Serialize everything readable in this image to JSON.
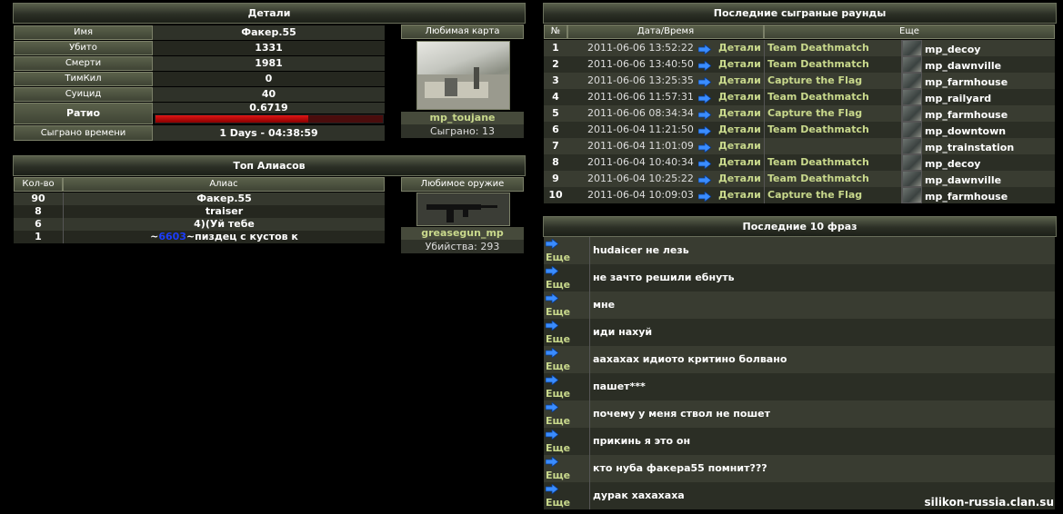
{
  "details": {
    "title": "Детали",
    "rows": [
      {
        "label": "Имя",
        "value": "Факер.55"
      },
      {
        "label": "Убито",
        "value": "1331"
      },
      {
        "label": "Смерти",
        "value": "1981"
      },
      {
        "label": "ТимКил",
        "value": "0"
      },
      {
        "label": "Суицид",
        "value": "40"
      }
    ],
    "ratio_label": "Ратио",
    "ratio_value": "0.6719",
    "ratio_fill": 0.67,
    "time_label": "Сыграно времени",
    "time_value": "1 Days - 04:38:59",
    "fav_map_title": "Любимая карта",
    "fav_map_name": "mp_toujane",
    "fav_map_played": "Сыграно: 13"
  },
  "aliases": {
    "title": "Топ Алиасов",
    "col_count": "Кол-во",
    "col_alias": "Алиас",
    "rows": [
      {
        "count": "90",
        "alias": "Факер.55"
      },
      {
        "count": "8",
        "alias": "traiser"
      },
      {
        "count": "6",
        "alias": "4)(Уй тебе"
      }
    ],
    "last_row": {
      "count": "1",
      "prefix": "~",
      "num": "6603",
      "suffix": "~пиздец с кустов к"
    },
    "fav_weapon_title": "Любимое оружие",
    "fav_weapon_name": "greasegun_mp",
    "fav_weapon_kills": "Убийства: 293"
  },
  "rounds": {
    "title": "Последние сыграные раунды",
    "col_no": "№",
    "col_date": "Дата/Время",
    "col_more": "Еще",
    "details_label": "Детали",
    "rows": [
      {
        "no": "1",
        "date": "2011-06-06 13:52:22",
        "mode": "Team Deathmatch",
        "map": "mp_decoy"
      },
      {
        "no": "2",
        "date": "2011-06-06 13:40:50",
        "mode": "Team Deathmatch",
        "map": "mp_dawnville"
      },
      {
        "no": "3",
        "date": "2011-06-06 13:25:35",
        "mode": "Capture the Flag",
        "map": "mp_farmhouse"
      },
      {
        "no": "4",
        "date": "2011-06-06 11:57:31",
        "mode": "Team Deathmatch",
        "map": "mp_railyard"
      },
      {
        "no": "5",
        "date": "2011-06-06 08:34:34",
        "mode": "Capture the Flag",
        "map": "mp_farmhouse"
      },
      {
        "no": "6",
        "date": "2011-06-04 11:21:50",
        "mode": "Team Deathmatch",
        "map": "mp_downtown"
      },
      {
        "no": "7",
        "date": "2011-06-04 11:01:09",
        "mode": "",
        "map": "mp_trainstation"
      },
      {
        "no": "8",
        "date": "2011-06-04 10:40:34",
        "mode": "Team Deathmatch",
        "map": "mp_decoy"
      },
      {
        "no": "9",
        "date": "2011-06-04 10:25:22",
        "mode": "Team Deathmatch",
        "map": "mp_dawnville"
      },
      {
        "no": "10",
        "date": "2011-06-04 10:09:03",
        "mode": "Capture the Flag",
        "map": "mp_farmhouse"
      }
    ]
  },
  "phrases": {
    "title": "Последние 10 фраз",
    "more_label": "Еще",
    "rows": [
      "hudaicer не лезь",
      "не зачто решили ебнуть",
      "мне",
      "иди нахуй",
      "аахахах идиото критино болвано",
      "пашет***",
      "почему у меня ствол не пошет",
      "прикинь я это он",
      "кто нуба факера55 помнит???",
      "дурак хахахаха"
    ]
  },
  "watermark": "silikon-russia.clan.su",
  "colors": {
    "bar_red": "#b00000",
    "mode_green": "#c9d98c",
    "alias_blue": "#1b3cff"
  }
}
